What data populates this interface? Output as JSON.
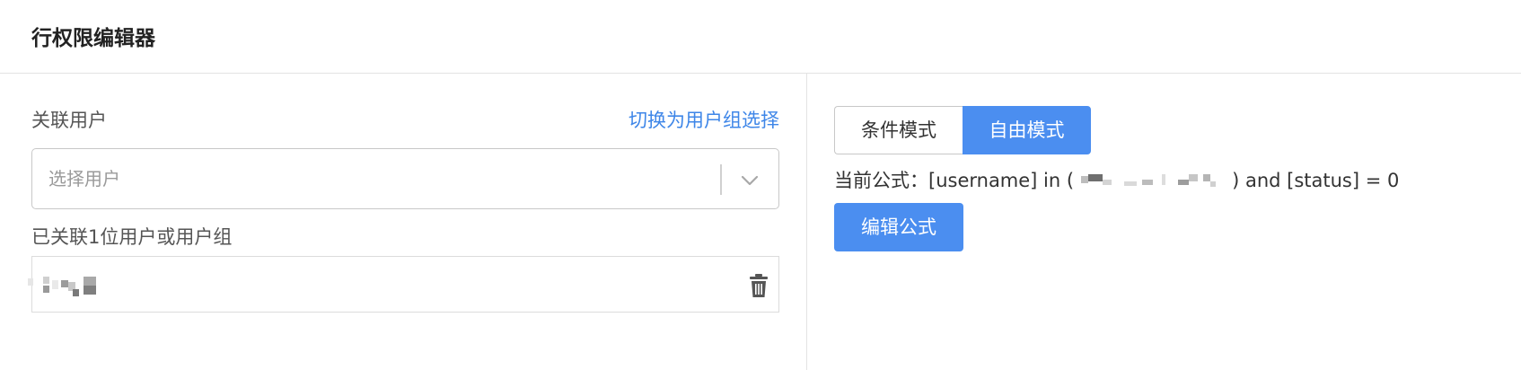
{
  "header": {
    "title": "行权限编辑器"
  },
  "left_panel": {
    "users_label": "关联用户",
    "switch_link": "切换为用户组选择",
    "user_select": {
      "placeholder": "选择用户",
      "icon": "chevron-down-icon"
    },
    "linked_summary": "已关联1位用户或用户组",
    "linked_items": [
      {
        "name_blurred": true,
        "delete_icon": "trash-icon"
      }
    ]
  },
  "right_panel": {
    "mode_buttons": {
      "condition": "条件模式",
      "free": "自由模式",
      "active": "free"
    },
    "formula": {
      "label": "当前公式：",
      "part_before": "[username] in (",
      "part_after": ") and [status] = 0"
    },
    "edit_button": "编辑公式"
  },
  "colors": {
    "accent": "#4b8ef0",
    "link": "#3e86e8",
    "border": "#c8c8c8"
  }
}
